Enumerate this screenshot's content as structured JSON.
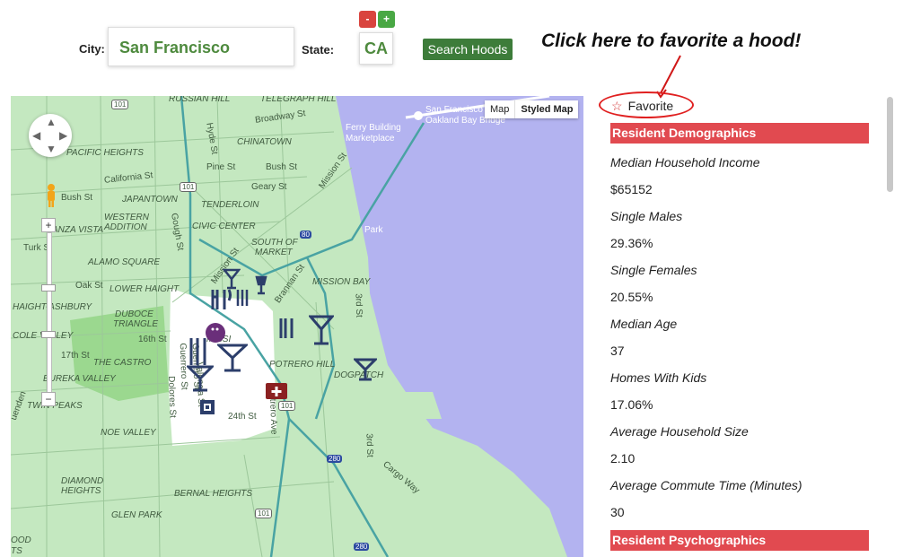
{
  "search": {
    "city_label": "City:",
    "city_value": "San Francisco",
    "state_label": "State:",
    "state_value": "CA",
    "minus": "-",
    "plus": "+",
    "search_button": "Search Hoods"
  },
  "callout": "Click here to favorite a hood!",
  "map": {
    "type_map": "Map",
    "type_styled": "Styled Map",
    "zoom_in": "+",
    "zoom_out": "−",
    "labels": {
      "russian_hill": "RUSSIAN HILL",
      "telegraph_hill": "TELEGRAPH HILL",
      "broadway_st": "Broadway St",
      "sf_bridge_1": "San Francisco",
      "sf_bridge_2": "Oakland Bay Bridge",
      "ferry_1": "Ferry Building",
      "ferry_2": "Marketplace",
      "pacific_heights": "PACIFIC HEIGHTS",
      "chinatown": "CHINATOWN",
      "california_st": "California St",
      "hyde_st": "Hyde St",
      "pine_st": "Pine St",
      "bush_st_e": "Bush St",
      "bush_st_w": "Bush St",
      "japantown": "JAPANTOWN",
      "tenderloin": "TENDERLOIN",
      "geary_st": "Geary St",
      "mission_st_n": "Mission St",
      "western_addition_1": "WESTERN",
      "western_addition_2": "ADDITION",
      "civic_center": "CIVIC CENTER",
      "gough_st": "Gough St",
      "nob": "Nob",
      "anza_vista": "ANZA VISTA",
      "south_of_market_1": "SOUTH OF",
      "south_of_market_2": "MARKET",
      "turk_st": "Turk St",
      "alamo_square": "ALAMO SQUARE",
      "mission_st_s": "Mission St",
      "brannan_st": "Brannan St",
      "oak_st": "Oak St",
      "lower_haight": "LOWER HAIGHT",
      "mission_bay": "MISSION BAY",
      "haight_ashbury": "HAIGHT-ASHBURY",
      "duboce_triangle_1": "DUBOCE",
      "duboce_triangle_2": "TRIANGLE",
      "third_st_n": "3rd St",
      "cole_valley": "COLE VALLEY",
      "sixteenth_st": "16th St",
      "seventeenth_st": "17th St",
      "the_castro": "THE CASTRO",
      "potrero_hill": "POTRERO HILL",
      "dogpatch": "DOGPATCH",
      "eureka_valley": "EUREKA VALLEY",
      "guerrero_st_1": "Guerrero St",
      "guerrero_st_2": "Guerrero St",
      "valencia_st": "Valencia St",
      "dolores_st": "Dolores St",
      "mission": "MISSI",
      "twin_peaks": "TWIN PEAKS",
      "twentyfourth_st": "24th St",
      "potrero_ave": "Potrero Ave",
      "noe_valley": "NOE VALLEY",
      "third_st_s": "3rd St",
      "diamond_heights_1": "DIAMOND",
      "diamond_heights_2": "HEIGHTS",
      "bernal_heights": "BERNAL HEIGHTS",
      "cargo_way": "Cargo Way",
      "glen_park": "GLEN PARK",
      "ood": "OOD",
      "ts": "TS",
      "park": "Park",
      "uenden": "uenden",
      "hwy_101_a": "101",
      "hwy_101_b": "101",
      "hwy_101_c": "101",
      "hwy_101_d": "101",
      "hwy_80": "80",
      "hwy_280_a": "280",
      "hwy_280_b": "280"
    }
  },
  "panel": {
    "favorite_star": "☆",
    "favorite_label": "Favorite",
    "section_demographics": "Resident Demographics",
    "section_psychographics": "Resident Psychographics",
    "stats": [
      {
        "label": "Median Household Income",
        "value": "$65152"
      },
      {
        "label": "Single Males",
        "value": "29.36%"
      },
      {
        "label": "Single Females",
        "value": "20.55%"
      },
      {
        "label": "Median Age",
        "value": "37"
      },
      {
        "label": "Homes With Kids",
        "value": "17.06%"
      },
      {
        "label": "Average Household Size",
        "value": "2.10"
      },
      {
        "label": "Average Commute Time (Minutes)",
        "value": "30"
      }
    ]
  },
  "colors": {
    "land": "#c4e8c0",
    "water": "#b3b3f0",
    "highlight": "#ffffff",
    "park": "#9bd88f",
    "section_header": "#e14a50",
    "brand_green": "#3d7c3a",
    "road": "#49a3a3",
    "poi_icon": "#2c3e6b"
  }
}
